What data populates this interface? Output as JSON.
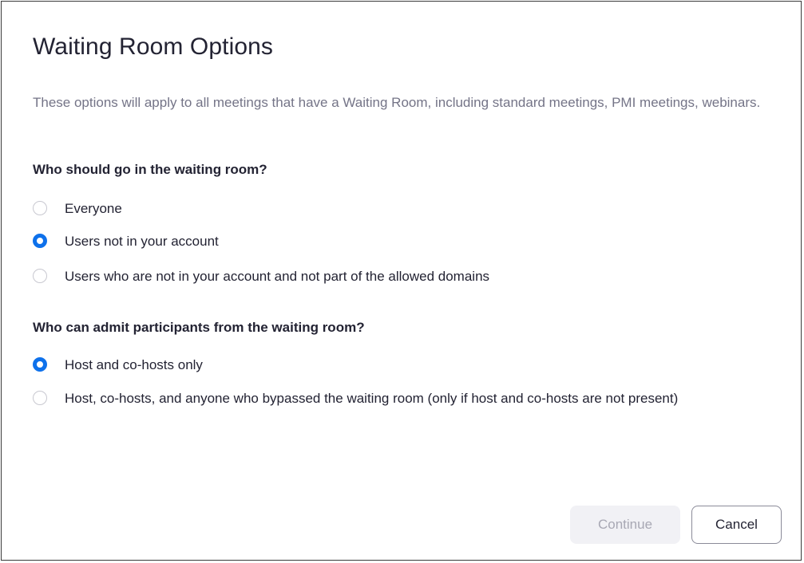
{
  "dialog": {
    "title": "Waiting Room Options",
    "description": "These options will apply to all meetings that have a Waiting Room, including standard meetings, PMI meetings, webinars."
  },
  "who_waits": {
    "heading": "Who should go in the waiting room?",
    "options": [
      {
        "label": "Everyone",
        "selected": false
      },
      {
        "label": "Users not in your account",
        "selected": true
      },
      {
        "label": "Users who are not in your account and not part of the allowed domains",
        "selected": false
      }
    ]
  },
  "who_admits": {
    "heading": "Who can admit participants from the waiting room?",
    "options": [
      {
        "label": "Host and co-hosts only",
        "selected": true
      },
      {
        "label": "Host, co-hosts, and anyone who bypassed the waiting room (only if host and co-hosts are not present)",
        "selected": false
      }
    ]
  },
  "buttons": {
    "continue_label": "Continue",
    "continue_enabled": false,
    "cancel_label": "Cancel"
  },
  "colors": {
    "accent": "#0e71eb",
    "title_text": "#232333",
    "description_text": "#747487",
    "disabled_button_bg": "#f1f1f5",
    "disabled_button_text": "#a8a8b4"
  }
}
